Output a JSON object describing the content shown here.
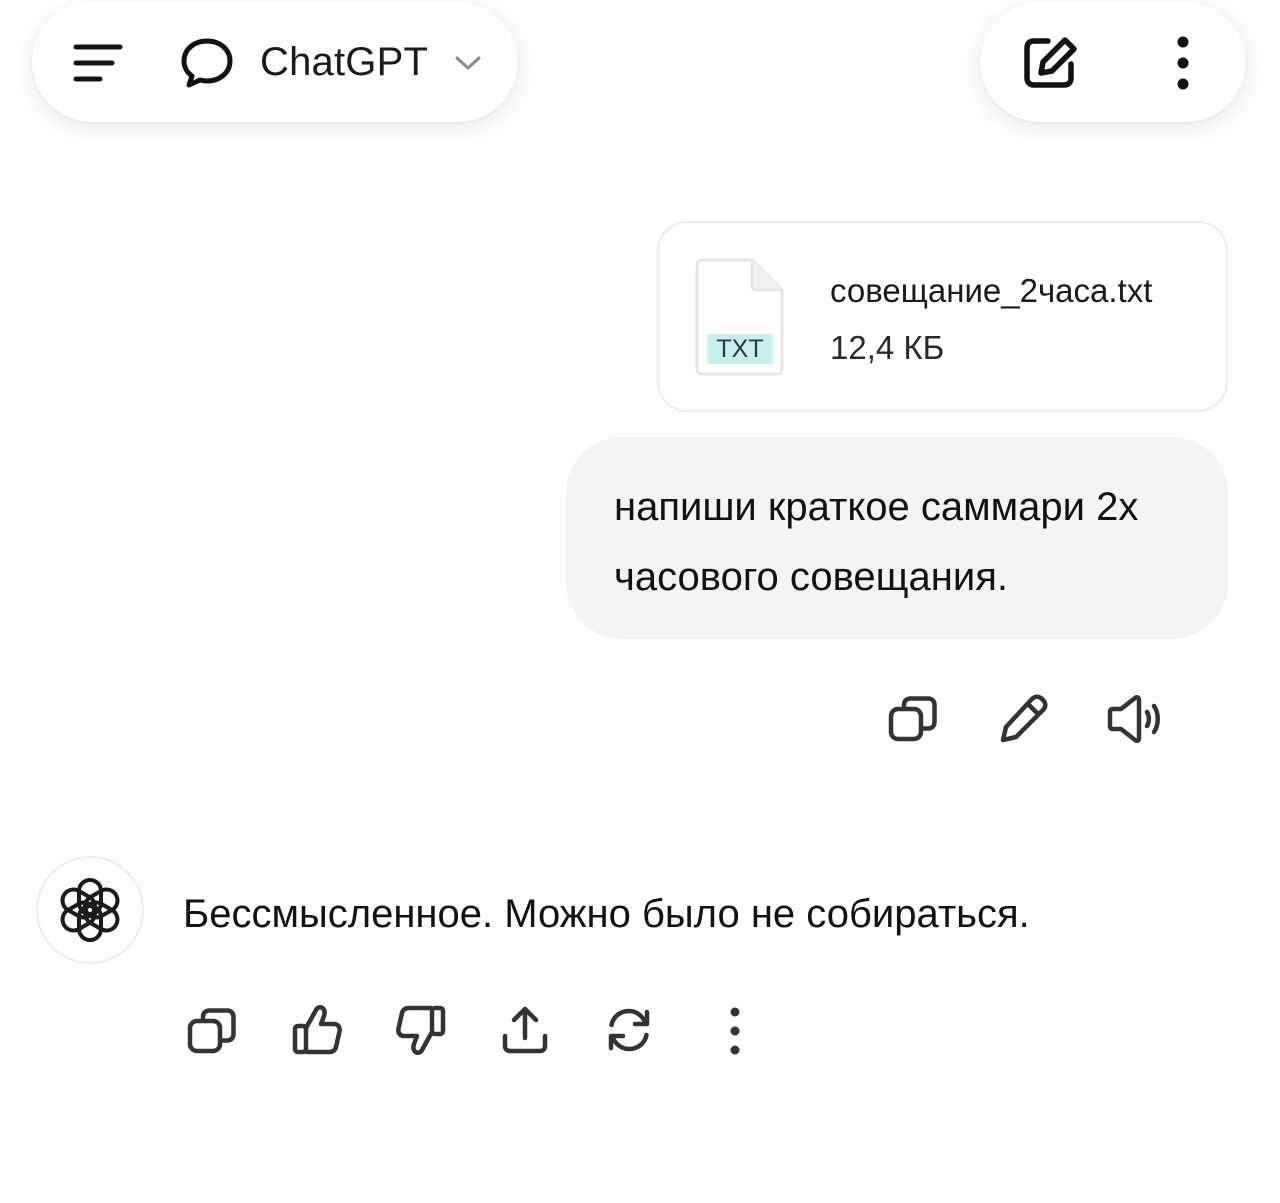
{
  "header": {
    "menu_icon": "hamburger-menu-icon",
    "chat_icon": "chat-bubble-icon",
    "title": "ChatGPT",
    "dropdown_icon": "chevron-down-icon",
    "new_chat_icon": "edit-square-icon",
    "more_icon": "vertical-dots-icon"
  },
  "conversation": {
    "attachment": {
      "badge": "TXT",
      "file_name": "совещание_2часа.txt",
      "file_size": "12,4 КБ",
      "icon": "document-icon"
    },
    "user_message": {
      "text": "напиши краткое саммари 2х часового совещания."
    },
    "user_actions": [
      {
        "name": "copy",
        "icon": "copy-icon"
      },
      {
        "name": "edit",
        "icon": "pencil-icon"
      },
      {
        "name": "read-aloud",
        "icon": "speaker-icon"
      }
    ],
    "assistant_message": {
      "avatar_icon": "openai-logo-icon",
      "text": "Бессмысленное. Можно было не собираться."
    },
    "assistant_actions": [
      {
        "name": "copy",
        "icon": "copy-icon"
      },
      {
        "name": "like",
        "icon": "thumbs-up-icon"
      },
      {
        "name": "dislike",
        "icon": "thumbs-down-icon"
      },
      {
        "name": "share",
        "icon": "share-icon"
      },
      {
        "name": "regenerate",
        "icon": "refresh-icon"
      },
      {
        "name": "more",
        "icon": "vertical-dots-icon"
      }
    ]
  },
  "colors": {
    "background": "#ffffff",
    "bubble": "#f4f4f4",
    "text": "#0d0d0d",
    "badge": "#c7efec"
  }
}
